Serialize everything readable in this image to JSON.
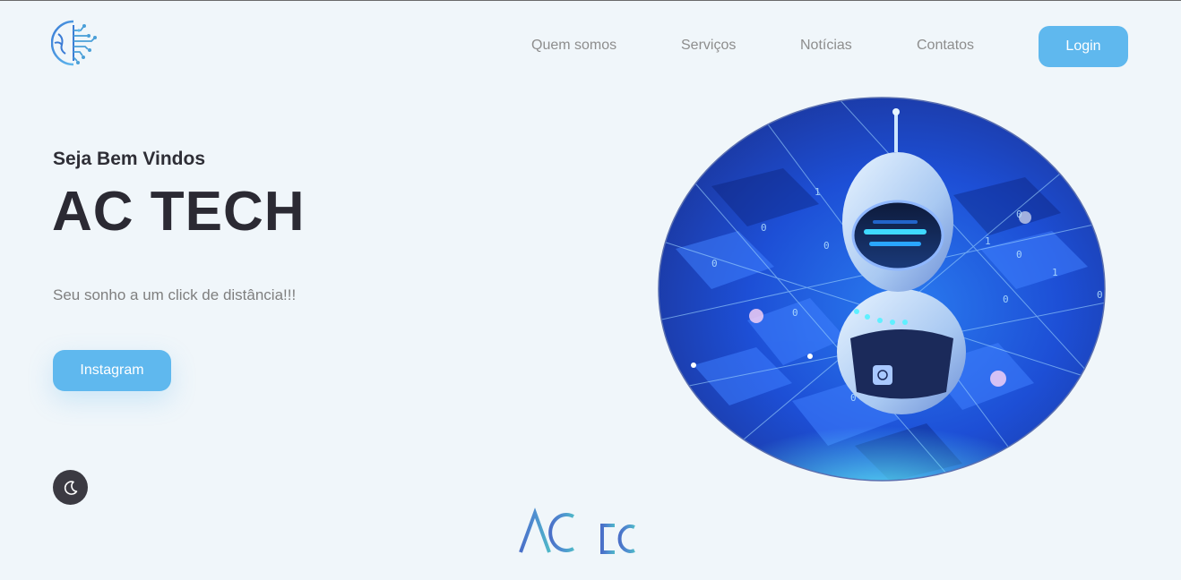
{
  "header": {
    "logo_icon": "circuit-globe-icon",
    "nav": [
      {
        "label": "Quem somos"
      },
      {
        "label": "Serviços"
      },
      {
        "label": "Notícias"
      },
      {
        "label": "Contatos"
      }
    ],
    "login_label": "Login"
  },
  "hero": {
    "subtitle": "Seja Bem Vindos",
    "title": "AC TECH",
    "tagline": "Seu sonho a um click de distância!!!",
    "instagram_label": "Instagram",
    "image": "robot-circuit-illustration"
  },
  "theme_toggle_icon": "moon-icon",
  "footer": {
    "brand_logo": "AC TECH"
  },
  "colors": {
    "accent": "#5fb8ee",
    "background": "#f0f6fa",
    "heading": "#2b2a33",
    "muted": "#8d8d8d"
  }
}
